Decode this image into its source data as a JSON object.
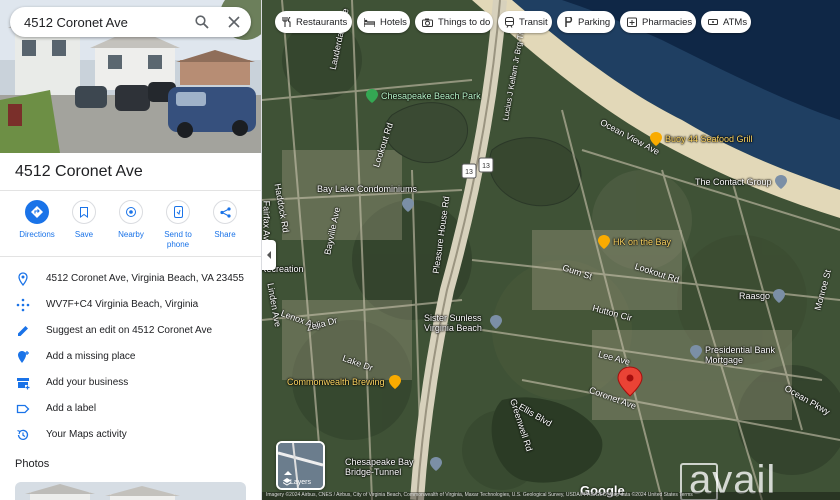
{
  "search": {
    "value": "4512 Coronet Ave"
  },
  "place": {
    "title": "4512 Coronet Ave"
  },
  "actions": [
    {
      "label": "Directions"
    },
    {
      "label": "Save"
    },
    {
      "label": "Nearby"
    },
    {
      "label": "Send to phone"
    },
    {
      "label": "Share"
    }
  ],
  "info_rows": [
    {
      "text": "4512 Coronet Ave, Virginia Beach, VA 23455",
      "icon": "location-pin-icon"
    },
    {
      "text": "WV7F+C4 Virginia Beach, Virginia",
      "icon": "plus-code-icon"
    },
    {
      "text": "Suggest an edit on 4512 Coronet Ave",
      "icon": "pencil-icon"
    },
    {
      "text": "Add a missing place",
      "icon": "add-location-icon"
    },
    {
      "text": "Add your business",
      "icon": "storefront-icon"
    },
    {
      "text": "Add a label",
      "icon": "label-icon"
    },
    {
      "text": "Your Maps activity",
      "icon": "history-icon"
    }
  ],
  "photos": {
    "title": "Photos"
  },
  "chips": [
    {
      "label": "Restaurants",
      "icon": "fork-knife-icon"
    },
    {
      "label": "Hotels",
      "icon": "bed-icon"
    },
    {
      "label": "Things to do",
      "icon": "camera-icon"
    },
    {
      "label": "Transit",
      "icon": "train-icon"
    },
    {
      "label": "Parking",
      "icon": "parking-icon"
    },
    {
      "label": "Pharmacies",
      "icon": "pharmacy-icon"
    },
    {
      "label": "ATMs",
      "icon": "atm-icon"
    }
  ],
  "map": {
    "pois": [
      {
        "label": "Chesapeake Beach Park",
        "type": "park"
      },
      {
        "label": "Buoy 44 Seafood Grill",
        "type": "food"
      },
      {
        "label": "The Contact Group",
        "type": "business"
      },
      {
        "label": "Bay Lake Condominiums",
        "type": "business"
      },
      {
        "label": "HK on the Bay",
        "type": "food"
      },
      {
        "label": "Raasgo",
        "type": "business"
      },
      {
        "label": "Sister Sunless Virginia Beach",
        "type": "business"
      },
      {
        "label": "Presidential Bank Mortgage",
        "type": "business"
      },
      {
        "label": "Commonwealth Brewing",
        "type": "food"
      },
      {
        "label": "Chesapeake Bay Bridge-Tunnel",
        "type": "landmark"
      },
      {
        "label": "Recreation",
        "type": "business"
      }
    ],
    "streets": [
      "Lauderdale Ave",
      "Lucius J Kellam Jr Brg-Tnl",
      "Ocean View Ave",
      "Lookout Rd",
      "Pleasure House Rd",
      "Bayville Ave",
      "Lake Dr",
      "Greenwell Rd",
      "Lee Ave",
      "Coronet Ave",
      "Gum St",
      "Fairfax Ave",
      "Linden Ave",
      "Lenox Ave",
      "Zelia Dr",
      "Ocean Pkwy",
      "Ellis Blvd",
      "Haddock Rd",
      "Lookout Rd",
      "Monroe St",
      "Hutton Cir"
    ],
    "route_shields": [
      "13",
      "13"
    ],
    "layers_label": "Layers",
    "google_label": "Google",
    "watermark": "avail",
    "credit": "Imagery ©2024 Airbus, CNES / Airbus, City of Virginia Beach, Commonwealth of Virginia, Maxar Technologies, U.S. Geological Survey, USDA/FPAC/GEO, Map data ©2024    United States    Terms"
  },
  "colors": {
    "accent": "#1a73e8",
    "pin_red": "#ea4335",
    "gold_poi": "#f9ab00",
    "green_poi": "#34a853"
  }
}
